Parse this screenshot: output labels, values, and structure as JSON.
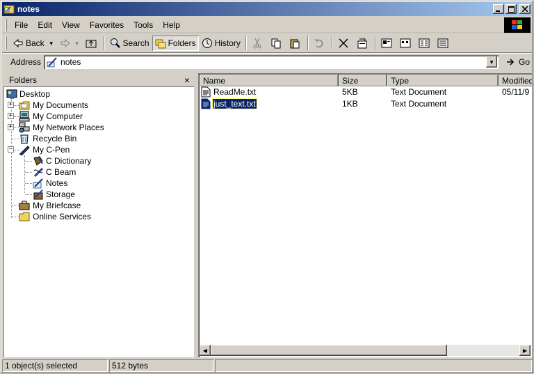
{
  "window": {
    "title": "notes",
    "min": "_",
    "max": "□",
    "close": "✕"
  },
  "menu": {
    "items": [
      "File",
      "Edit",
      "View",
      "Favorites",
      "Tools",
      "Help"
    ]
  },
  "toolbar": {
    "back": "Back",
    "search": "Search",
    "folders": "Folders",
    "history": "History"
  },
  "address": {
    "label": "Address",
    "value": "notes",
    "go": "Go"
  },
  "folders_pane": {
    "title": "Folders",
    "close": "×",
    "tree": [
      {
        "label": "Desktop",
        "icon": "desktop-icon",
        "level": 0
      },
      {
        "label": "My Documents",
        "icon": "my-documents-icon",
        "level": 1,
        "expander": "+"
      },
      {
        "label": "My Computer",
        "icon": "my-computer-icon",
        "level": 1,
        "expander": "+"
      },
      {
        "label": "My Network Places",
        "icon": "network-places-icon",
        "level": 1,
        "expander": "+"
      },
      {
        "label": "Recycle Bin",
        "icon": "recycle-bin-icon",
        "level": 1
      },
      {
        "label": "My C-Pen",
        "icon": "cpen-icon",
        "level": 1,
        "expander": "−"
      },
      {
        "label": "C Dictionary",
        "icon": "dictionary-icon",
        "level": 2
      },
      {
        "label": "C Beam",
        "icon": "beam-icon",
        "level": 2
      },
      {
        "label": "Notes",
        "icon": "notes-icon",
        "level": 2
      },
      {
        "label": "Storage",
        "icon": "storage-icon",
        "level": 2
      },
      {
        "label": "My Briefcase",
        "icon": "briefcase-icon",
        "level": 1
      },
      {
        "label": "Online Services",
        "icon": "folder-icon",
        "level": 1
      }
    ]
  },
  "files": {
    "columns": [
      "Name",
      "Size",
      "Type",
      "Modified"
    ],
    "rows": [
      {
        "name": "ReadMe.txt",
        "size": "5KB",
        "type": "Text Document",
        "modified": "05/11/9",
        "selected": false
      },
      {
        "name": "just_text.txt",
        "size": "1KB",
        "type": "Text Document",
        "modified": "",
        "selected": true
      }
    ]
  },
  "status": {
    "selection": "1 object(s) selected",
    "size": "512 bytes"
  }
}
